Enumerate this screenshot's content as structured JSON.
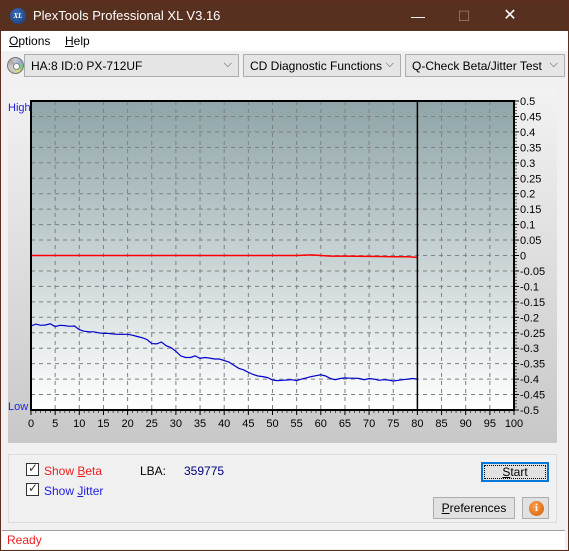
{
  "window": {
    "title": "PlexTools Professional XL V3.16",
    "app_icon_text": "XL",
    "minimize_glyph": "—",
    "maximize_glyph": "☐",
    "close_glyph": "✕"
  },
  "menu": {
    "items": [
      {
        "label": "Options",
        "mnemonic": "O",
        "rest": "ptions"
      },
      {
        "label": "Help",
        "mnemonic": "H",
        "rest": "elp"
      }
    ]
  },
  "toolbar": {
    "drive_select": "HA:8 ID:0  PX-712UF",
    "function_select": "CD Diagnostic Functions",
    "test_select": "Q-Check Beta/Jitter Test",
    "chevron_glyph": "⌵"
  },
  "chart": {
    "high_label": "High",
    "low_label": "Low"
  },
  "chart_data": {
    "type": "line",
    "title": "",
    "xlabel": "",
    "ylabel": "",
    "xlim": [
      0,
      100
    ],
    "ylim": [
      -0.5,
      0.5
    ],
    "x_ticks": [
      "0",
      "5",
      "10",
      "15",
      "20",
      "25",
      "30",
      "35",
      "40",
      "45",
      "50",
      "55",
      "60",
      "65",
      "70",
      "75",
      "80",
      "85",
      "90",
      "95",
      "100"
    ],
    "y_ticks": [
      "0.5",
      "0.45",
      "0.4",
      "0.35",
      "0.3",
      "0.25",
      "0.2",
      "0.15",
      "0.1",
      "0.05",
      "0",
      "-0.05",
      "-0.1",
      "-0.15",
      "-0.2",
      "-0.25",
      "-0.3",
      "-0.35",
      "-0.4",
      "-0.45",
      "-0.5"
    ],
    "grid": true,
    "end_marker_x": 80,
    "background_colors": {
      "top": "#8fa5a8",
      "bottom": "#ffffff"
    },
    "series": [
      {
        "name": "Beta",
        "color": "#ff0000",
        "x": [
          0,
          10,
          20,
          30,
          40,
          50,
          55,
          58,
          60,
          62,
          65,
          70,
          75,
          78,
          80
        ],
        "values": [
          0.0,
          0.0,
          0.0,
          0.0,
          0.0,
          0.0,
          0.0,
          0.002,
          0.0,
          -0.002,
          -0.002,
          -0.003,
          -0.004,
          -0.004,
          -0.006
        ]
      },
      {
        "name": "Jitter",
        "color": "#0000cc",
        "x": [
          0,
          1,
          2,
          3,
          4,
          5,
          6,
          7,
          8,
          9,
          10,
          11,
          12,
          13,
          14,
          15,
          16,
          17,
          18,
          19,
          20,
          21,
          22,
          23,
          24,
          25,
          26,
          27,
          28,
          29,
          30,
          31,
          32,
          33,
          34,
          35,
          36,
          37,
          38,
          39,
          40,
          41,
          42,
          43,
          44,
          45,
          46,
          47,
          48,
          49,
          50,
          51,
          52,
          53,
          54,
          55,
          56,
          57,
          58,
          59,
          60,
          61,
          62,
          63,
          64,
          65,
          66,
          67,
          68,
          69,
          70,
          71,
          72,
          73,
          74,
          75,
          76,
          77,
          78,
          79,
          80
        ],
        "values": [
          -0.228,
          -0.222,
          -0.226,
          -0.225,
          -0.221,
          -0.23,
          -0.226,
          -0.227,
          -0.229,
          -0.228,
          -0.24,
          -0.245,
          -0.247,
          -0.247,
          -0.25,
          -0.252,
          -0.252,
          -0.254,
          -0.255,
          -0.255,
          -0.255,
          -0.258,
          -0.262,
          -0.266,
          -0.272,
          -0.285,
          -0.286,
          -0.28,
          -0.292,
          -0.298,
          -0.31,
          -0.325,
          -0.33,
          -0.33,
          -0.325,
          -0.333,
          -0.33,
          -0.332,
          -0.335,
          -0.335,
          -0.34,
          -0.345,
          -0.355,
          -0.365,
          -0.37,
          -0.378,
          -0.385,
          -0.39,
          -0.392,
          -0.395,
          -0.403,
          -0.405,
          -0.404,
          -0.403,
          -0.402,
          -0.405,
          -0.4,
          -0.396,
          -0.392,
          -0.389,
          -0.386,
          -0.39,
          -0.398,
          -0.402,
          -0.398,
          -0.396,
          -0.397,
          -0.397,
          -0.398,
          -0.402,
          -0.398,
          -0.4,
          -0.404,
          -0.402,
          -0.403,
          -0.406,
          -0.404,
          -0.402,
          -0.4,
          -0.398,
          -0.4
        ]
      }
    ]
  },
  "controls": {
    "show_beta": {
      "label_pre": "Show ",
      "mnemonic": "B",
      "label_post": "eta",
      "checked": true
    },
    "show_jitter": {
      "label_pre": "Show ",
      "mnemonic": "J",
      "label_post": "itter",
      "checked": true
    },
    "lba_label": "LBA:",
    "lba_value": "359775",
    "start_button": {
      "mnemonic": "S",
      "rest": "tart"
    },
    "preferences_button": {
      "mnemonic": "P",
      "rest": "references"
    },
    "info_glyph": "i"
  },
  "status": {
    "text": "Ready"
  }
}
